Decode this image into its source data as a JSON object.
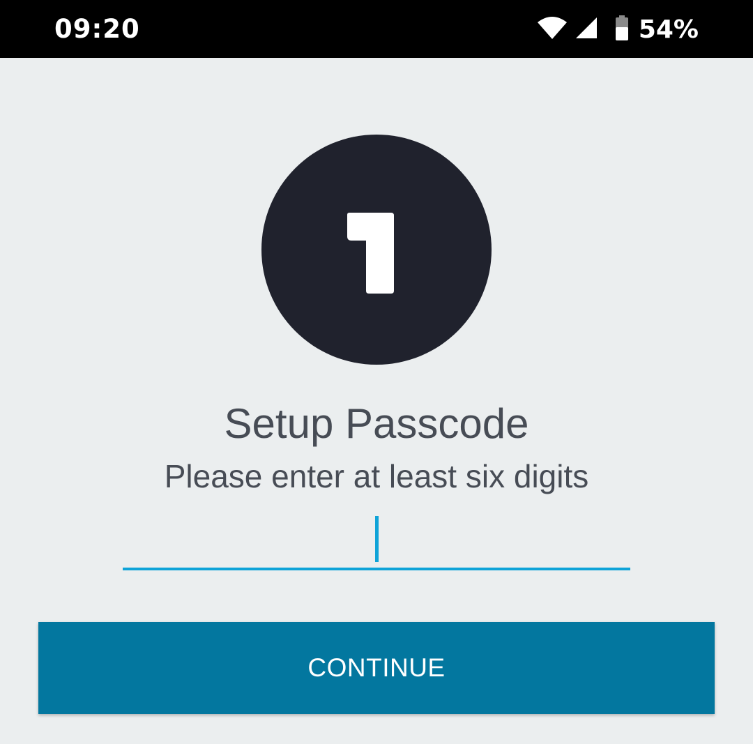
{
  "status_bar": {
    "time": "09:20",
    "battery": "54%",
    "icons": [
      "wifi-icon",
      "signal-icon",
      "battery-icon"
    ]
  },
  "logo": {
    "icon": "app-logo-1-icon"
  },
  "passcode": {
    "title": "Setup Passcode",
    "subtitle": "Please enter at least six digits",
    "value": ""
  },
  "actions": {
    "continue_label": "CONTINUE"
  },
  "colors": {
    "accent": "#0ea3d8",
    "button": "#03779f",
    "logo_bg": "#20222d",
    "background": "#ebeeef",
    "text": "#474c55"
  }
}
